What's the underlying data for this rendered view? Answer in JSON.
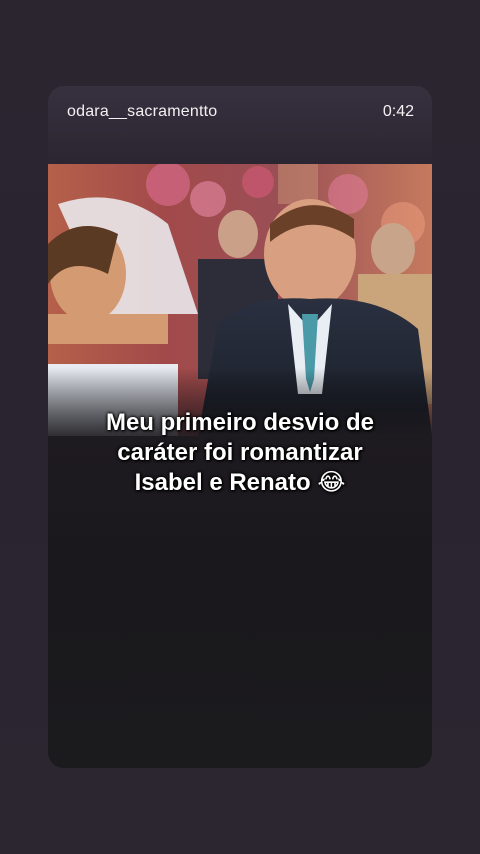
{
  "story": {
    "username": "odara__sacramentto",
    "duration": "0:42",
    "caption_lines": [
      "Meu primeiro desvio de",
      "caráter foi romantizar",
      "Isabel e Renato 😂"
    ]
  },
  "icons": {
    "emoji": "laughing-tears-emoji"
  },
  "colors": {
    "background": "#2b2530",
    "caption": "#ffffff"
  }
}
